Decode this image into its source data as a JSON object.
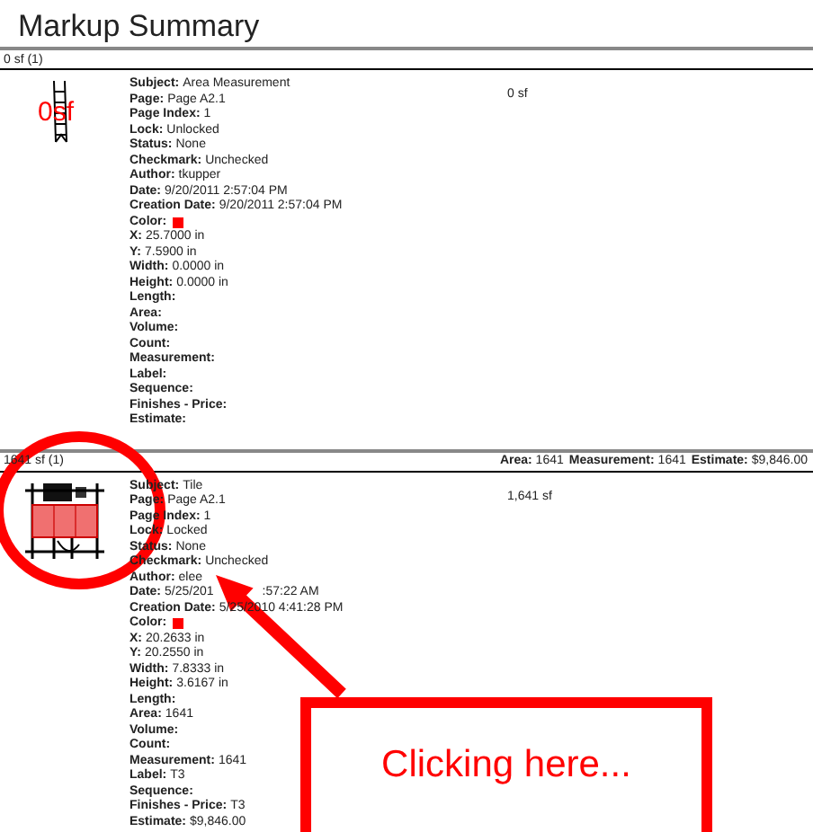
{
  "title": "Markup Summary",
  "groups": [
    {
      "header": "0 sf (1)",
      "markups": [
        {
          "thumbnail": {
            "kind": "measure",
            "label": "0sf"
          },
          "result": "0 sf",
          "fields": [
            {
              "label": "Subject:",
              "value": "Area Measurement"
            },
            {
              "label": "Page:",
              "value": "Page A2.1"
            },
            {
              "label": "Page Index:",
              "value": "1"
            },
            {
              "label": "Lock:",
              "value": "Unlocked"
            },
            {
              "label": "Status:",
              "value": "None"
            },
            {
              "label": "Checkmark:",
              "value": "Unchecked"
            },
            {
              "label": "Author:",
              "value": "tkupper"
            },
            {
              "label": "Date:",
              "value": "9/20/2011 2:57:04 PM"
            },
            {
              "label": "Creation Date:",
              "value": "9/20/2011 2:57:04 PM"
            },
            {
              "label": "Color:",
              "kind": "color",
              "color": "#ff0000"
            },
            {
              "label": "X:",
              "value": "25.7000 in"
            },
            {
              "label": "Y:",
              "value": "7.5900 in"
            },
            {
              "label": "Width:",
              "value": "0.0000 in"
            },
            {
              "label": "Height:",
              "value": "0.0000 in"
            },
            {
              "label": "Length:"
            },
            {
              "label": "Area:"
            },
            {
              "label": "Volume:"
            },
            {
              "label": "Count:"
            },
            {
              "label": "Measurement:"
            },
            {
              "label": "Label:"
            },
            {
              "label": "Sequence:"
            },
            {
              "label": "Finishes - Price:"
            },
            {
              "label": "Estimate:"
            }
          ]
        }
      ]
    },
    {
      "header": "1641 sf (1)",
      "totals": [
        {
          "label": "Area:",
          "value": "1641"
        },
        {
          "label": "Measurement:",
          "value": "1641"
        },
        {
          "label": "Estimate:",
          "value": "$9,846.00"
        }
      ],
      "markups": [
        {
          "thumbnail": {
            "kind": "plan"
          },
          "result": "1,641 sf",
          "fields": [
            {
              "label": "Subject:",
              "value": "Tile"
            },
            {
              "label": "Page:",
              "value": "Page A2.1"
            },
            {
              "label": "Page Index:",
              "value": "1"
            },
            {
              "label": "Lock:",
              "value": "Locked"
            },
            {
              "label": "Status:",
              "value": "None"
            },
            {
              "label": "Checkmark:",
              "value": "Unchecked"
            },
            {
              "label": "Author:",
              "value": "elee"
            },
            {
              "label": "Date:",
              "value": "5/25/201",
              "value_tail": ":57:22 AM"
            },
            {
              "label": "Creation Date:",
              "value": "5/25/2010 4:41:28 PM"
            },
            {
              "label": "Color:",
              "kind": "color",
              "color": "#ff0000"
            },
            {
              "label": "X:",
              "value": "20.2633 in"
            },
            {
              "label": "Y:",
              "value": "20.2550 in"
            },
            {
              "label": "Width:",
              "value": "7.8333 in"
            },
            {
              "label": "Height:",
              "value": "3.6167 in"
            },
            {
              "label": "Length:"
            },
            {
              "label": "Area:",
              "value": "1641"
            },
            {
              "label": "Volume:"
            },
            {
              "label": "Count:"
            },
            {
              "label": "Measurement:",
              "value": "1641"
            },
            {
              "label": "Label:",
              "value": "T3"
            },
            {
              "label": "Sequence:"
            },
            {
              "label": "Finishes - Price:",
              "value": "T3"
            },
            {
              "label": "Estimate:",
              "value": "$9,846.00"
            }
          ]
        }
      ]
    }
  ],
  "annotation": {
    "callout": "Clicking here..."
  }
}
